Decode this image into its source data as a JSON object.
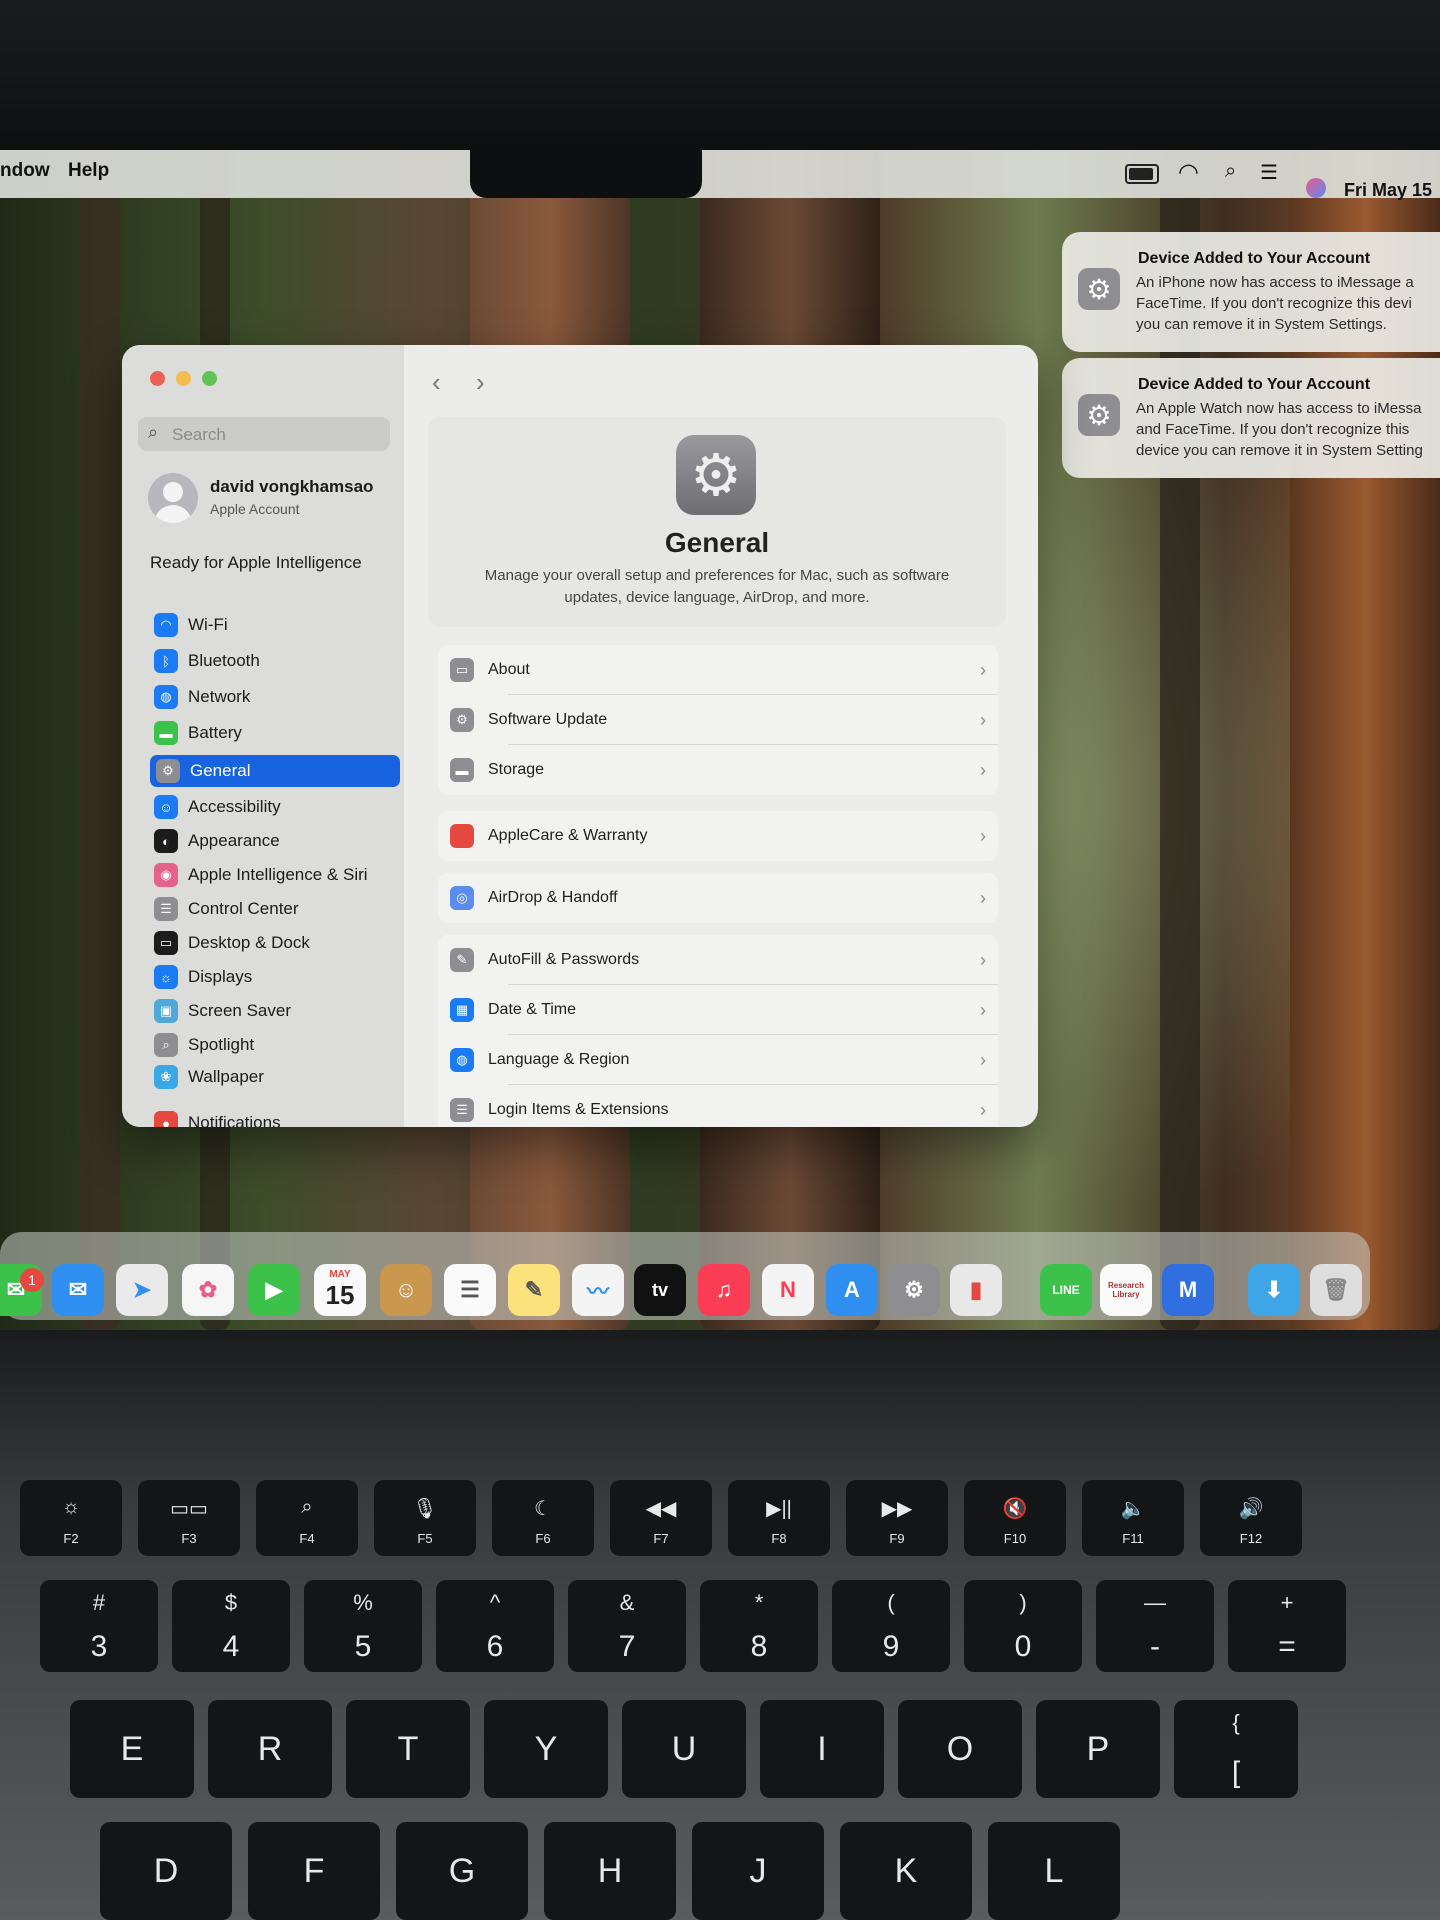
{
  "menubar": {
    "left_items": [
      "ndow",
      "Help"
    ],
    "clock": "Fri May 15"
  },
  "window": {
    "search_placeholder": "Search",
    "account": {
      "name": "david vongkhamsao",
      "subtitle": "Apple Account"
    },
    "intelligence_banner": "Ready for Apple Intelligence",
    "sidebar_items": [
      {
        "label": "Wi-Fi",
        "icon": "wifi-icon",
        "color": "#1b7bf5"
      },
      {
        "label": "Bluetooth",
        "icon": "bluetooth-icon",
        "color": "#1b7bf5"
      },
      {
        "label": "Network",
        "icon": "globe-icon",
        "color": "#1b7bf5"
      },
      {
        "label": "Battery",
        "icon": "battery-icon",
        "color": "#3cc24a"
      },
      {
        "label": "General",
        "icon": "gear-icon",
        "color": "#8e8e92",
        "selected": true
      },
      {
        "label": "Accessibility",
        "icon": "accessibility-icon",
        "color": "#1b7bf5"
      },
      {
        "label": "Appearance",
        "icon": "appearance-icon",
        "color": "#1c1c1c"
      },
      {
        "label": "Apple Intelligence & Siri",
        "icon": "siri-icon",
        "color": "#e6628a"
      },
      {
        "label": "Control Center",
        "icon": "control-center-icon",
        "color": "#8e8e92"
      },
      {
        "label": "Desktop & Dock",
        "icon": "dock-icon",
        "color": "#1c1c1c"
      },
      {
        "label": "Displays",
        "icon": "displays-icon",
        "color": "#1b7bf5"
      },
      {
        "label": "Screen Saver",
        "icon": "screen-saver-icon",
        "color": "#4fa8d8"
      },
      {
        "label": "Spotlight",
        "icon": "spotlight-icon",
        "color": "#8e8e92"
      },
      {
        "label": "Wallpaper",
        "icon": "wallpaper-icon",
        "color": "#3aa7e6"
      },
      {
        "label": "Notifications",
        "icon": "notifications-icon",
        "color": "#e5483e"
      }
    ],
    "header": {
      "title": "General",
      "description_line1": "Manage your overall setup and preferences for Mac, such as software",
      "description_line2": "updates, device language, AirDrop, and more."
    },
    "rows": [
      {
        "label": "About",
        "icon": "laptop-icon",
        "color": "#8e8e92"
      },
      {
        "label": "Software Update",
        "icon": "software-update-icon",
        "color": "#8e8e92"
      },
      {
        "label": "Storage",
        "icon": "storage-icon",
        "color": "#8e8e92"
      },
      {
        "label": "AppleCare & Warranty",
        "icon": "apple-icon",
        "color": "#e5483e"
      },
      {
        "label": "AirDrop & Handoff",
        "icon": "airdrop-icon",
        "color": "#5b8cf0"
      },
      {
        "label": "AutoFill & Passwords",
        "icon": "autofill-icon",
        "color": "#8e8e92"
      },
      {
        "label": "Date & Time",
        "icon": "calendar-clock-icon",
        "color": "#1b7bf5"
      },
      {
        "label": "Language & Region",
        "icon": "globe-icon",
        "color": "#1b7bf5"
      },
      {
        "label": "Login Items & Extensions",
        "icon": "list-icon",
        "color": "#8e8e92"
      }
    ]
  },
  "notifications": [
    {
      "title": "Device Added to Your Account",
      "lines": [
        "An iPhone now has access to iMessage a",
        "FaceTime. If you don't recognize this devi",
        "you can remove it in System Settings."
      ]
    },
    {
      "title": "Device Added to Your Account",
      "lines": [
        "An Apple Watch now has access to iMessa",
        "and FaceTime. If you don't recognize this",
        "device you can remove it in System Setting"
      ]
    }
  ],
  "dock": {
    "messages_badge": "1",
    "calendar_month": "MAY",
    "calendar_day": "15",
    "tv_label": "tv",
    "line_label": "LINE",
    "research_label": "Research Library"
  },
  "keyboard": {
    "fn_keys": [
      "F2",
      "F3",
      "F4",
      "F5",
      "F6",
      "F7",
      "F8",
      "F9",
      "F10",
      "F11",
      "F12"
    ],
    "num_keys": [
      {
        "top": "#",
        "bot": "3"
      },
      {
        "top": "$",
        "bot": "4"
      },
      {
        "top": "%",
        "bot": "5"
      },
      {
        "top": "^",
        "bot": "6"
      },
      {
        "top": "&",
        "bot": "7"
      },
      {
        "top": "*",
        "bot": "8"
      },
      {
        "top": "(",
        "bot": "9"
      },
      {
        "top": ")",
        "bot": "0"
      },
      {
        "top": "—",
        "bot": "-"
      },
      {
        "top": "+",
        "bot": "="
      }
    ],
    "letter_row1": [
      "E",
      "R",
      "T",
      "Y",
      "U",
      "I",
      "O",
      "P"
    ],
    "bracket_key": {
      "top": "{",
      "bot": "["
    },
    "letter_row2": [
      "D",
      "F",
      "G",
      "H",
      "J",
      "K",
      "L"
    ]
  }
}
